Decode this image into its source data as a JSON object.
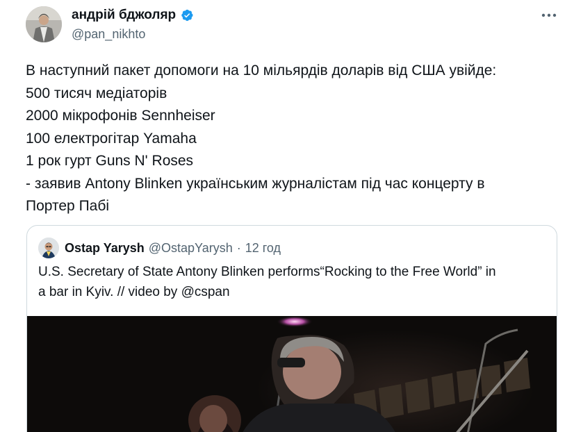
{
  "author": {
    "display_name": "андрій бджоляр",
    "handle": "@pan_nikhto",
    "verified": true
  },
  "tweet": {
    "lines": [
      "В наступний пакет допомоги на 10 мільярдів доларів від США увійде:",
      "500 тисяч медіаторів",
      "2000 мікрофонів Sennheiser",
      "100 електрогітар Yamaha",
      "1 рок гурт Guns N' Roses",
      "- заявив Antony Blinken українським журналістам під час концерту в",
      "Портер Пабі"
    ]
  },
  "quote": {
    "display_name": "Ostap Yarysh",
    "handle": "@OstapYarysh",
    "separator": "·",
    "time": "12 год",
    "text_lines": [
      "U.S. Secretary of State Antony Blinken performs“Rocking to the Free World” in",
      "a bar in Kyiv. // video by @cspan"
    ],
    "media_type": "video"
  },
  "icons": {
    "verified": "verified-badge-icon",
    "more": "more-options-icon"
  },
  "colors": {
    "text": "#0f1419",
    "secondary": "#536471",
    "verified": "#1d9bf0",
    "border": "#cfd9de"
  }
}
